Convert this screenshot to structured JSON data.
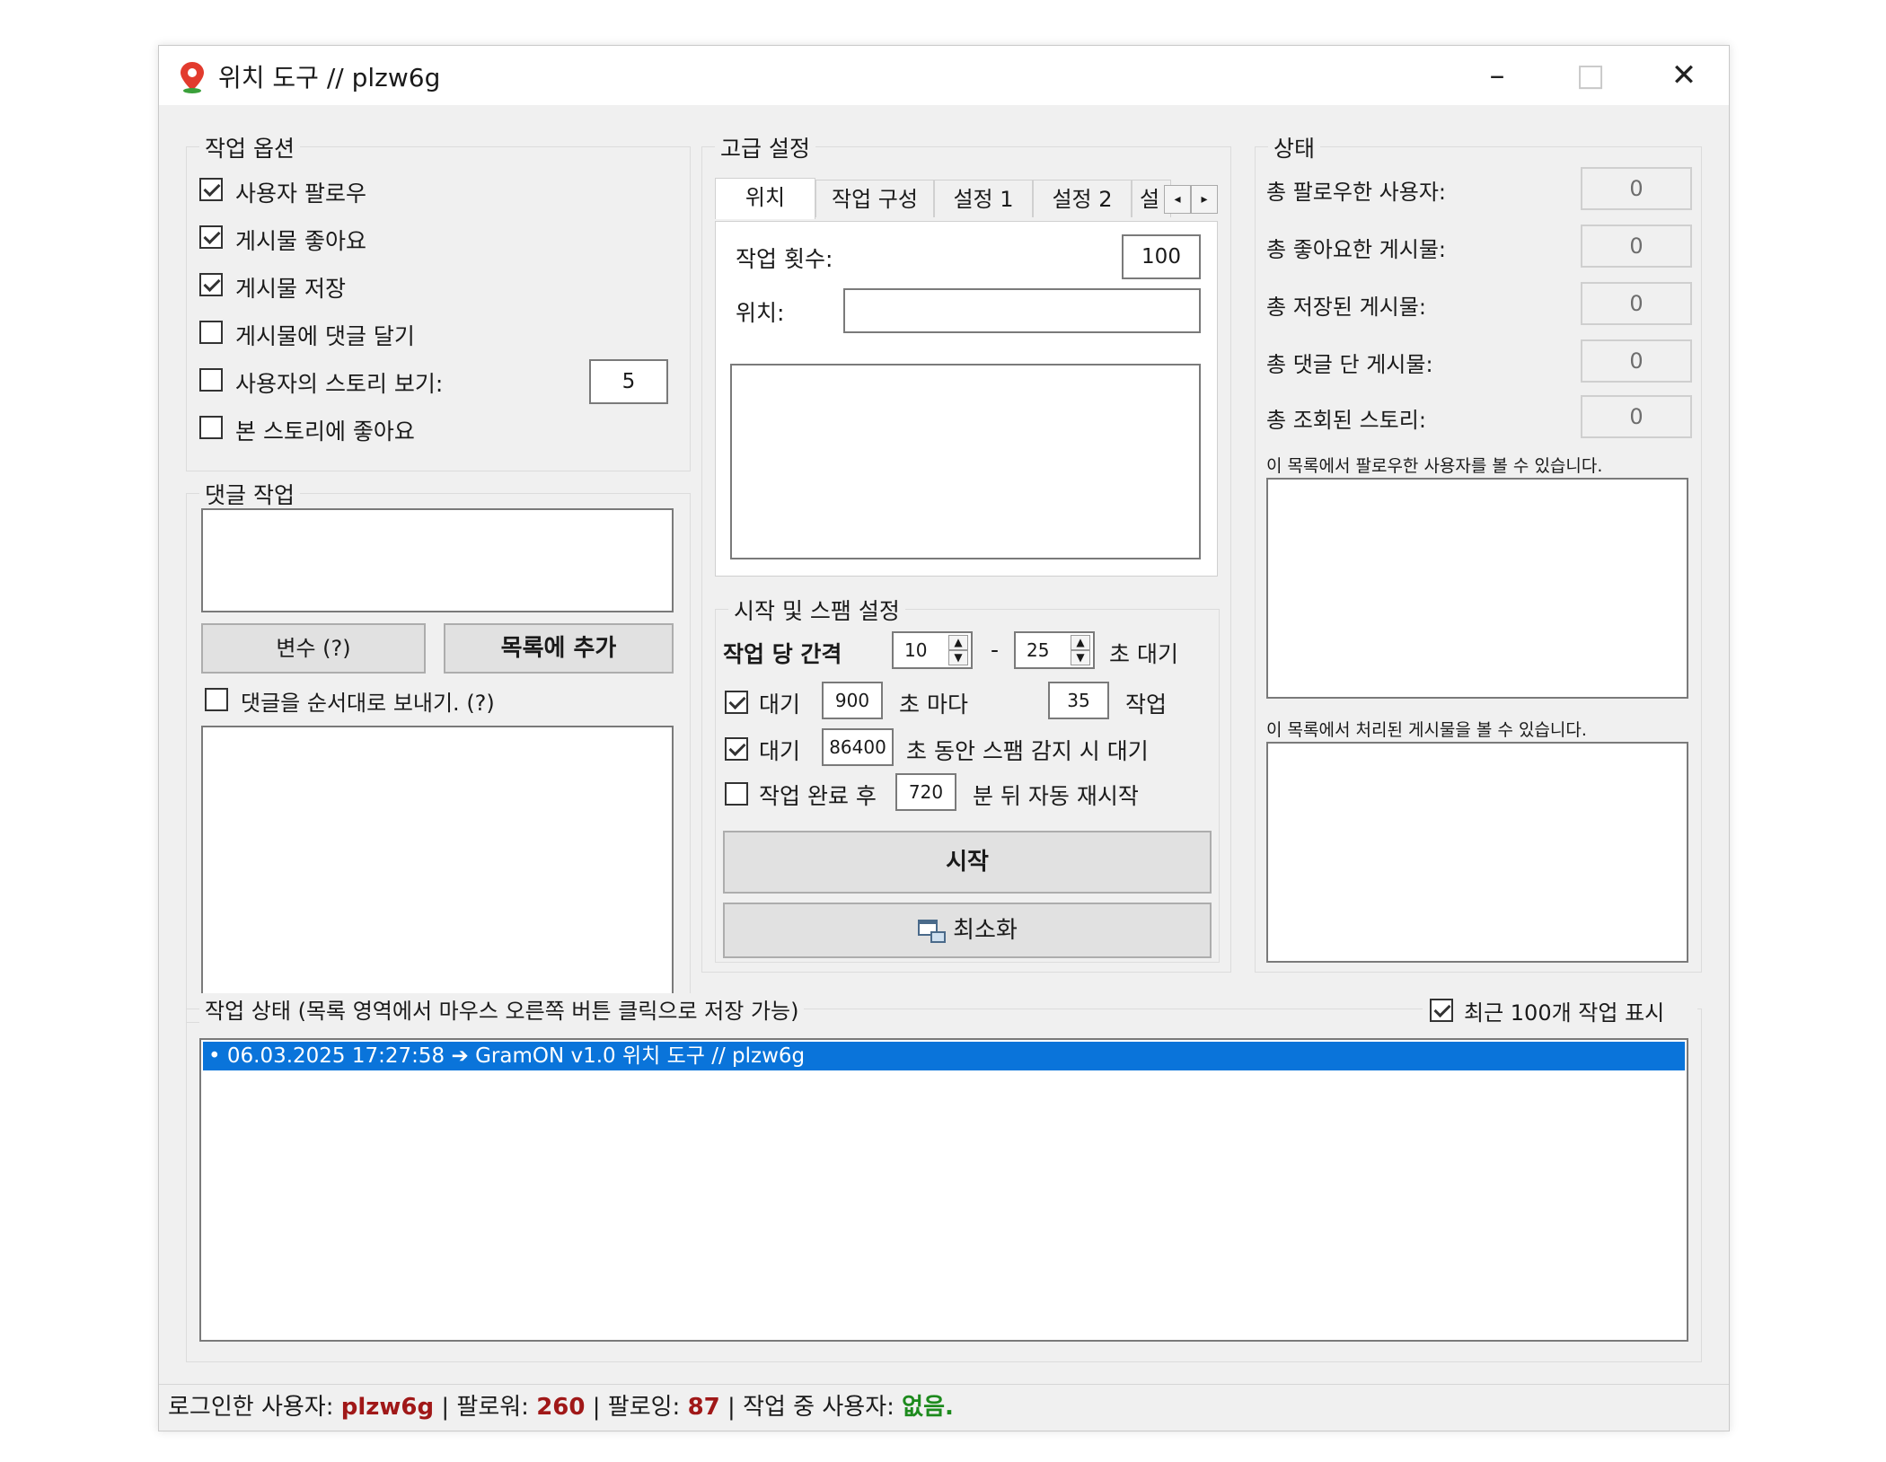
{
  "window": {
    "title": "위치 도구 // plzw6g"
  },
  "job_options": {
    "title": "작업 옵션",
    "items": [
      {
        "label": "사용자 팔로우",
        "checked": true
      },
      {
        "label": "게시물 좋아요",
        "checked": true
      },
      {
        "label": "게시물 저장",
        "checked": true
      },
      {
        "label": "게시물에 댓글 달기",
        "checked": false
      },
      {
        "label": "사용자의 스토리 보기:",
        "checked": false
      },
      {
        "label": "본 스토리에 좋아요",
        "checked": false
      }
    ],
    "story_count": "5"
  },
  "comment_job": {
    "title": "댓글 작업",
    "variables_button": "변수 (?)",
    "add_to_list_button": "목록에 추가",
    "send_in_order_label": "댓글을 순서대로 보내기. (?)"
  },
  "advanced": {
    "title": "고급 설정",
    "tabs": [
      "위치",
      "작업 구성",
      "설정 1",
      "설정 2",
      "설"
    ],
    "job_count_label": "작업 횟수:",
    "job_count_value": "100",
    "location_label": "위치:",
    "location_value": ""
  },
  "start_spam": {
    "title": "시작 및 스팸 설정",
    "interval_label": "작업 당 간격",
    "interval_min": "10",
    "interval_dash": "-",
    "interval_max": "25",
    "interval_suffix": "초 대기",
    "wait1_label": "대기",
    "wait1_value": "900",
    "wait1_mid": "초 마다",
    "wait1_count": "35",
    "wait1_suffix": "작업",
    "wait2_label": "대기",
    "wait2_value": "86400",
    "wait2_suffix": "초 동안 스팸 감지 시 대기",
    "restart_label": "작업 완료 후",
    "restart_value": "720",
    "restart_suffix": "분 뒤 자동 재시작",
    "start_button": "시작",
    "minimize_button": "최소화"
  },
  "status": {
    "title": "상태",
    "rows": [
      {
        "label": "총 팔로우한 사용자:",
        "value": "0"
      },
      {
        "label": "총 좋아요한 게시물:",
        "value": "0"
      },
      {
        "label": "총 저장된 게시물:",
        "value": "0"
      },
      {
        "label": "총 댓글 단 게시물:",
        "value": "0"
      },
      {
        "label": "총 조회된 스토리:",
        "value": "0"
      }
    ],
    "followed_list_caption": "이 목록에서 팔로우한 사용자를 볼 수 있습니다.",
    "processed_list_caption": "이 목록에서 처리된 게시물을 볼 수 있습니다."
  },
  "job_status": {
    "title": "작업 상태 (목록 영역에서 마우스 오른쪽 버튼 클릭으로 저장 가능)",
    "recent_label": "최근 100개 작업 표시",
    "log_entries": [
      "• 06.03.2025 17:27:58 ➔ GramON v1.0 위치 도구 // plzw6g"
    ]
  },
  "statusbar": {
    "logged_in_label": "로그인한 사용자:",
    "username": "plzw6g",
    "sep": "|",
    "followers_label": "팔로워:",
    "followers": "260",
    "following_label": "팔로잉:",
    "following": "87",
    "working_label": "작업 중 사용자:",
    "working_value": "없음."
  },
  "colors": {
    "selection": "#0a74da",
    "red_value": "#a01818",
    "green_value": "#1d8a1d"
  }
}
